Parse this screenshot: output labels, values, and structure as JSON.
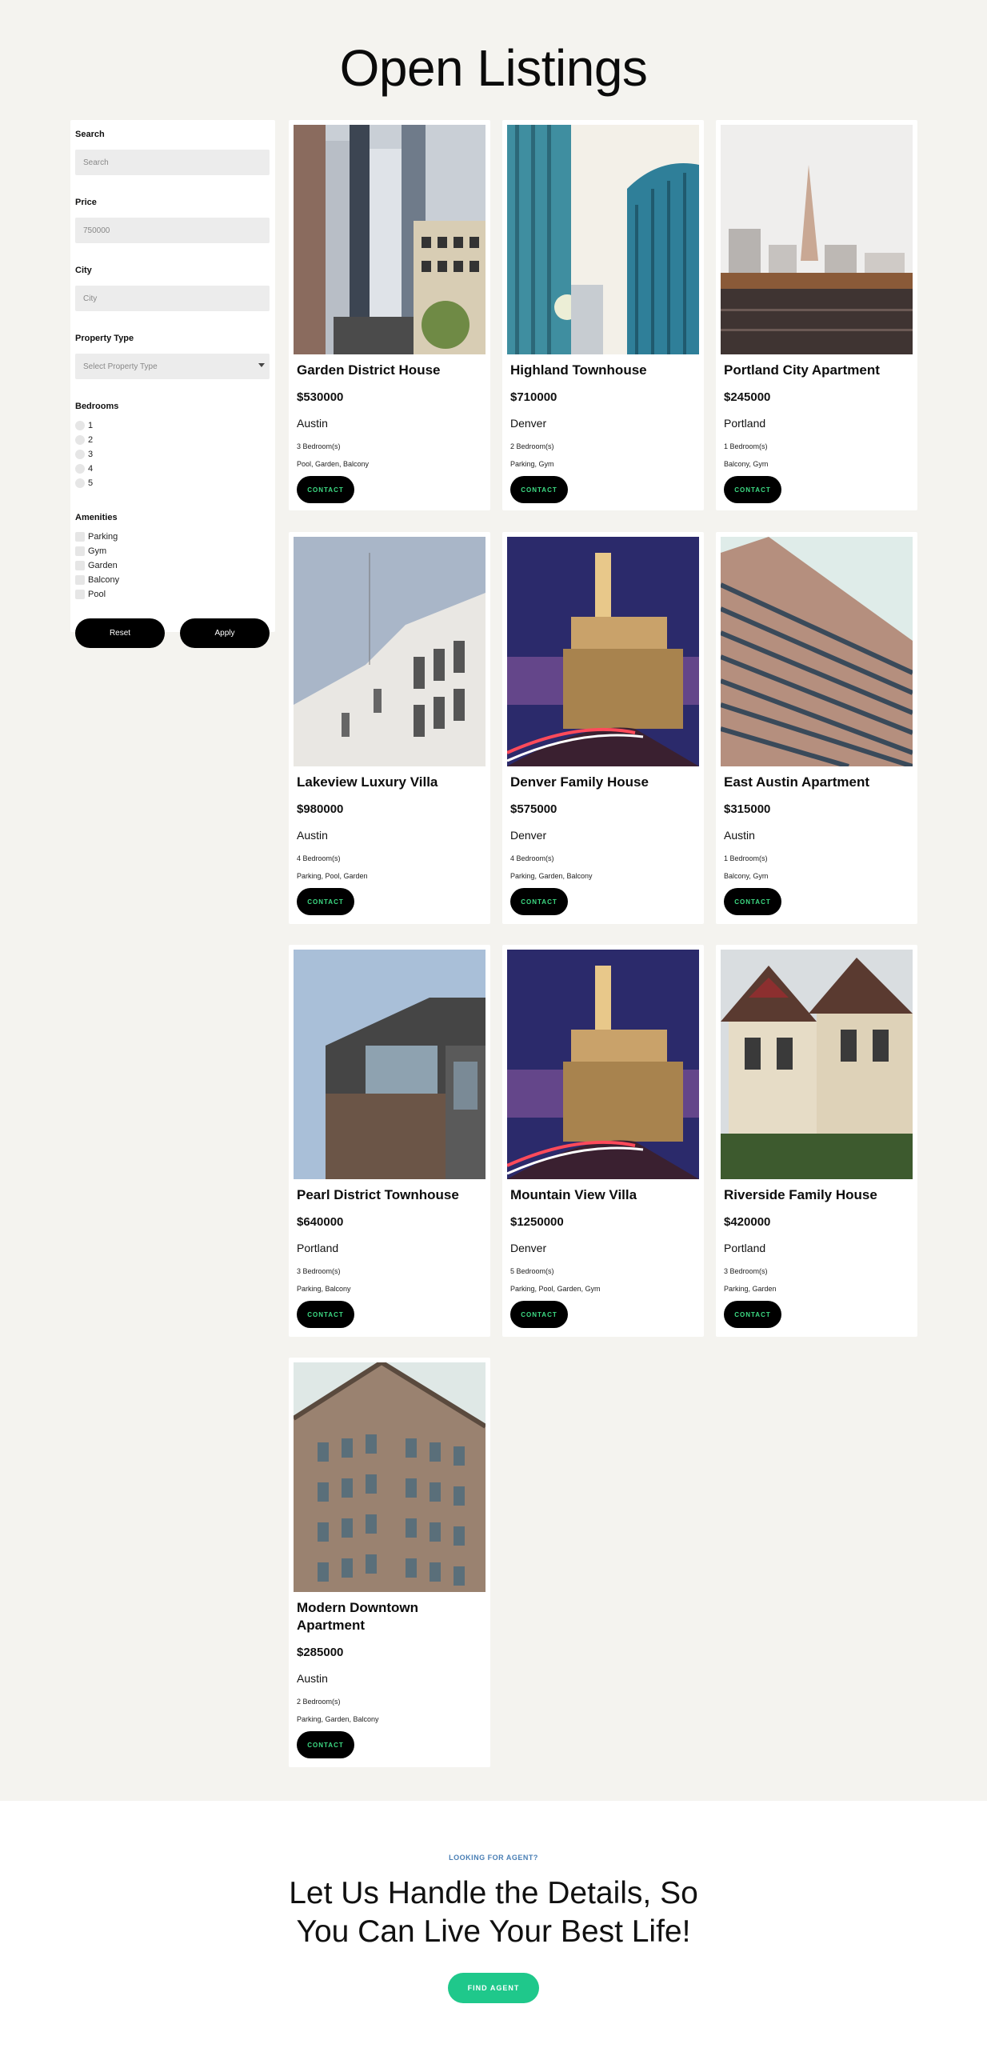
{
  "page": {
    "title": "Open Listings"
  },
  "filters": {
    "search": {
      "label": "Search",
      "placeholder": "Search"
    },
    "price": {
      "label": "Price",
      "placeholder": "750000"
    },
    "city": {
      "label": "City",
      "placeholder": "City"
    },
    "property_type": {
      "label": "Property Type",
      "placeholder": "Select Property Type"
    },
    "bedrooms": {
      "label": "Bedrooms",
      "options": [
        "1",
        "2",
        "3",
        "4",
        "5"
      ]
    },
    "amenities": {
      "label": "Amenities",
      "options": [
        "Parking",
        "Gym",
        "Garden",
        "Balcony",
        "Pool"
      ]
    },
    "reset_label": "Reset",
    "apply_label": "Apply"
  },
  "listings": [
    {
      "title": "Garden District House",
      "price": "$530000",
      "city": "Austin",
      "bedrooms": "3 Bedroom(s)",
      "amenities": "Pool, Garden, Balcony",
      "contact": "CONTACT",
      "image": "city-street-photo"
    },
    {
      "title": "Highland Townhouse",
      "price": "$710000",
      "city": "Denver",
      "bedrooms": "2 Bedroom(s)",
      "amenities": "Parking, Gym",
      "contact": "CONTACT",
      "image": "glass-towers-photo"
    },
    {
      "title": "Portland City Apartment",
      "price": "$245000",
      "city": "Portland",
      "bedrooms": "1 Bedroom(s)",
      "amenities": "Balcony, Gym",
      "contact": "CONTACT",
      "image": "waterfront-skyline-photo"
    },
    {
      "title": "Lakeview Luxury Villa",
      "price": "$980000",
      "city": "Austin",
      "bedrooms": "4 Bedroom(s)",
      "amenities": "Parking, Pool, Garden",
      "contact": "CONTACT",
      "image": "white-building-photo"
    },
    {
      "title": "Denver Family House",
      "price": "$575000",
      "city": "Denver",
      "bedrooms": "4 Bedroom(s)",
      "amenities": "Parking, Garden, Balcony",
      "contact": "CONTACT",
      "image": "clock-tower-night-photo"
    },
    {
      "title": "East Austin Apartment",
      "price": "$315000",
      "city": "Austin",
      "bedrooms": "1 Bedroom(s)",
      "amenities": "Balcony, Gym",
      "contact": "CONTACT",
      "image": "high-rise-facade-photo"
    },
    {
      "title": "Pearl District Townhouse",
      "price": "$640000",
      "city": "Portland",
      "bedrooms": "3 Bedroom(s)",
      "amenities": "Parking, Balcony",
      "contact": "CONTACT",
      "image": "modern-house-photo"
    },
    {
      "title": "Mountain View Villa",
      "price": "$1250000",
      "city": "Denver",
      "bedrooms": "5 Bedroom(s)",
      "amenities": "Parking, Pool, Garden, Gym",
      "contact": "CONTACT",
      "image": "clock-tower-night-photo"
    },
    {
      "title": "Riverside Family House",
      "price": "$420000",
      "city": "Portland",
      "bedrooms": "3 Bedroom(s)",
      "amenities": "Parking, Garden",
      "contact": "CONTACT",
      "image": "victorian-houses-photo"
    },
    {
      "title": "Modern Downtown Apartment",
      "price": "$285000",
      "city": "Austin",
      "bedrooms": "2 Bedroom(s)",
      "amenities": "Parking, Garden, Balcony",
      "contact": "CONTACT",
      "image": "classic-building-photo"
    }
  ],
  "cta": {
    "kicker": "LOOKING FOR AGENT?",
    "headline": "Let Us Handle the Details, So You Can Live Your Best Life!",
    "button": "FIND AGENT"
  },
  "colors": {
    "accent_green": "#1fc88b",
    "contact_text": "#3ddc84",
    "kicker_blue": "#4a7fb5",
    "background": "#f4f3ef"
  }
}
